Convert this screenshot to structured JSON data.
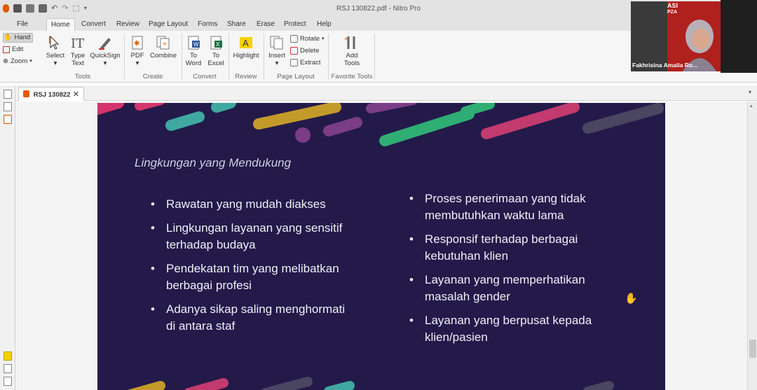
{
  "window": {
    "title": "RSJ 130822.pdf - Nitro Pro"
  },
  "menu": {
    "tabs": [
      "File",
      "Home",
      "Convert",
      "Review",
      "Page Layout",
      "Forms",
      "Share",
      "Erase",
      "Protect",
      "Help"
    ],
    "active": "Home"
  },
  "modes": {
    "hand": "Hand",
    "edit": "Edit",
    "zoom": "Zoom"
  },
  "ribbon": {
    "tools": {
      "select": "Select",
      "type_text": "Type Text",
      "quicksign": "QuickSign",
      "label": "Tools"
    },
    "create": {
      "pdf": "PDF",
      "combine": "Combine",
      "label": "Create"
    },
    "convert": {
      "to_word": "To Word",
      "to_excel": "To Excel",
      "label": "Convert"
    },
    "review": {
      "highlight": "Highlight",
      "label": "Review"
    },
    "page_layout": {
      "insert": "Insert",
      "rotate": "Rotate",
      "delete": "Delete",
      "extract": "Extract",
      "label": "Page Layout"
    },
    "favorite": {
      "add_tools": "Add Tools",
      "label": "Favorite Tools"
    }
  },
  "document_tab": {
    "label": "RSJ 130822",
    "close": "✕"
  },
  "slide": {
    "title": "Lingkungan yang Mendukung",
    "left_bullets": [
      "Rawatan yang mudah diakses",
      "Lingkungan layanan yang sensitif terhadap budaya",
      "Pendekatan tim yang melibatkan berbagai profesi",
      "Adanya sikap saling menghormati di antara staf"
    ],
    "right_bullets": [
      "Proses penerimaan yang tidak membutuhkan waktu lama",
      "Responsif terhadap berbagai kebutuhan klien",
      "Layanan yang memperhatikan masalah gender",
      "Layanan yang berpusat kepada klien/pasien"
    ]
  },
  "webcam": {
    "name": "Fakhrisina Amalia Ro...",
    "badge_line1": "ASI",
    "badge_line2": "PZA"
  },
  "colors": {
    "slide_bg": "#231a4a",
    "accent": "#e8c000",
    "ribbon_bg": "#f6f6f6"
  }
}
